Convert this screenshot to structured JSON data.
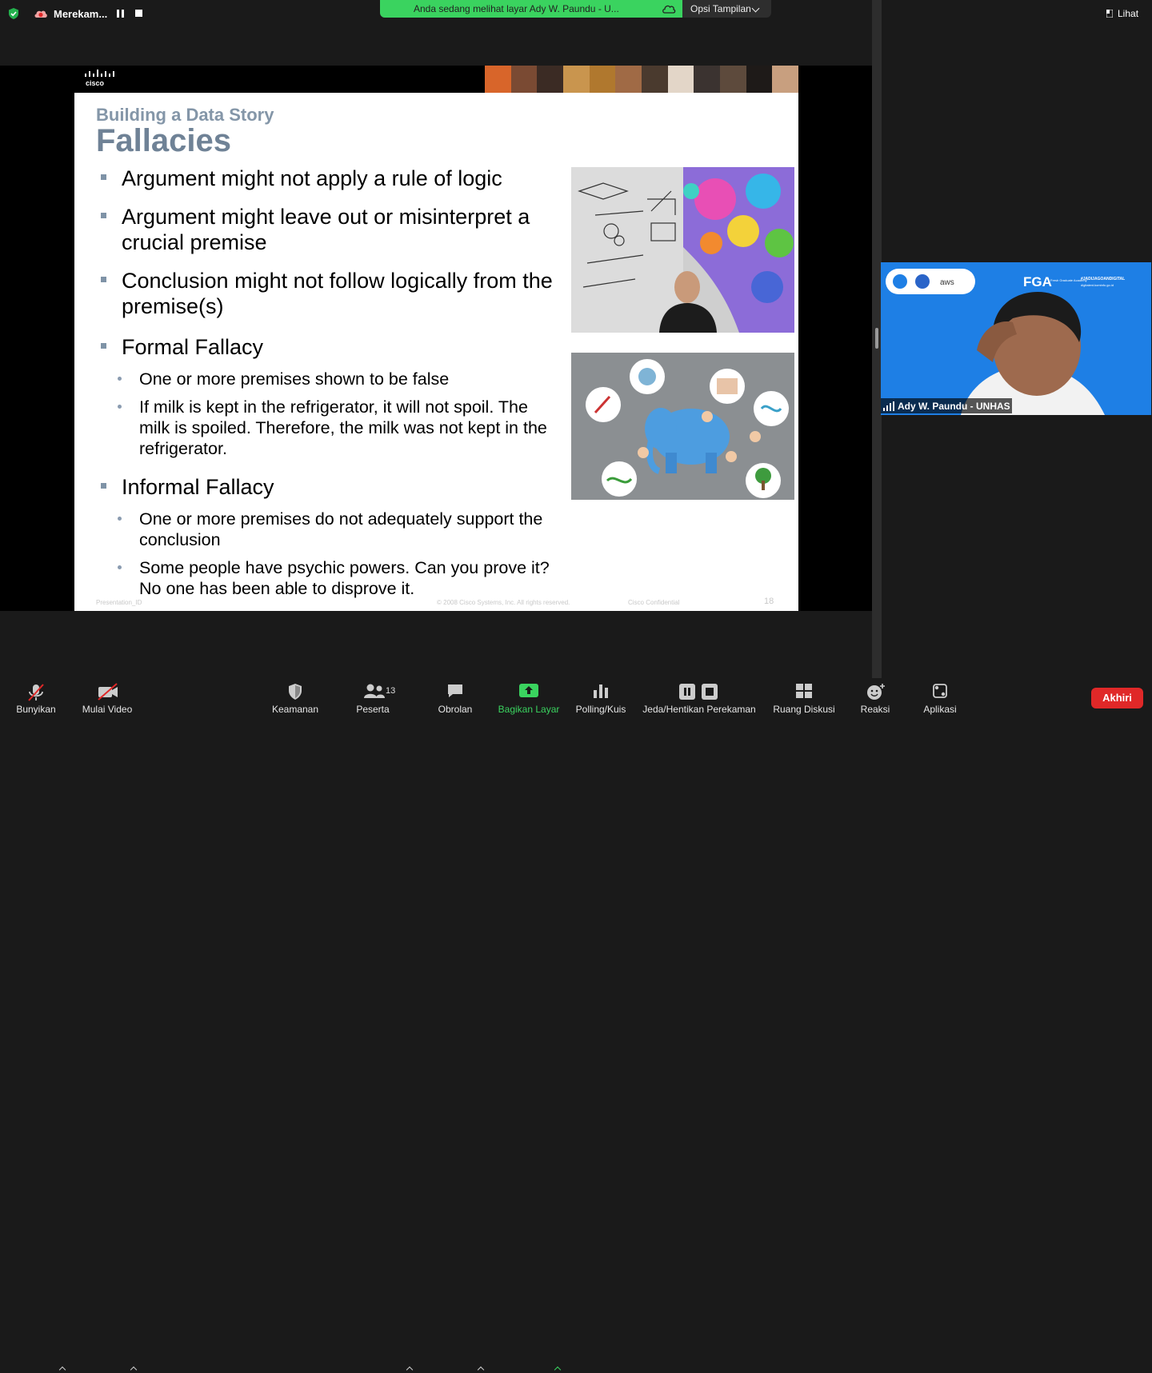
{
  "topbar": {
    "recording_label": "Merekam...",
    "share_banner": "Anda sedang melihat layar Ady W. Paundu - U...",
    "view_options": "Opsi Tampilan",
    "view_button": "Lihat"
  },
  "slide": {
    "subtitle": "Building a Data Story",
    "title": "Fallacies",
    "bullets": [
      "Argument might not apply a rule of logic",
      "Argument might leave out or misinterpret a crucial premise",
      "Conclusion might not follow logically from the premise(s)",
      "Formal Fallacy",
      "Informal Fallacy"
    ],
    "formal_sub": [
      "One or more premises shown to be false",
      "If milk is kept in the refrigerator, it will not spoil. The milk is spoiled. Therefore, the milk was not kept in the refrigerator."
    ],
    "informal_sub": [
      "One or more premises do not adequately support the conclusion",
      "Some people have psychic powers. Can you prove it? No one has been able to disprove it."
    ],
    "footer_left": "Presentation_ID",
    "footer_copyright": "© 2008 Cisco Systems, Inc. All rights reserved.",
    "footer_confidential": "Cisco Confidential",
    "page_number": "18",
    "logo_text": "cisco"
  },
  "participant": {
    "name": "Ady W. Paundu - UNHAS",
    "banner_text": "FGA",
    "banner_tag": "#JADIJAGOANDIGITAL",
    "banner_url": "digitalent.kominfo.go.id",
    "banner_caption": "Fresh Graduate Academy",
    "banner_logo": "aws"
  },
  "toolbar": {
    "unmute": "Bunyikan",
    "start_video": "Mulai Video",
    "security": "Keamanan",
    "participants": "Peserta",
    "participant_count": "13",
    "chat": "Obrolan",
    "share_screen": "Bagikan Layar",
    "polls": "Polling/Kuis",
    "pause_recording": "Jeda/Hentikan Perekaman",
    "breakout": "Ruang Diskusi",
    "reactions": "Reaksi",
    "apps": "Aplikasi",
    "end": "Akhiri"
  },
  "colors": {
    "share_green": "#3ad35f",
    "end_red": "#e02828",
    "slide_title": "#6f8296",
    "tile_blue": "#1e7fe5"
  }
}
